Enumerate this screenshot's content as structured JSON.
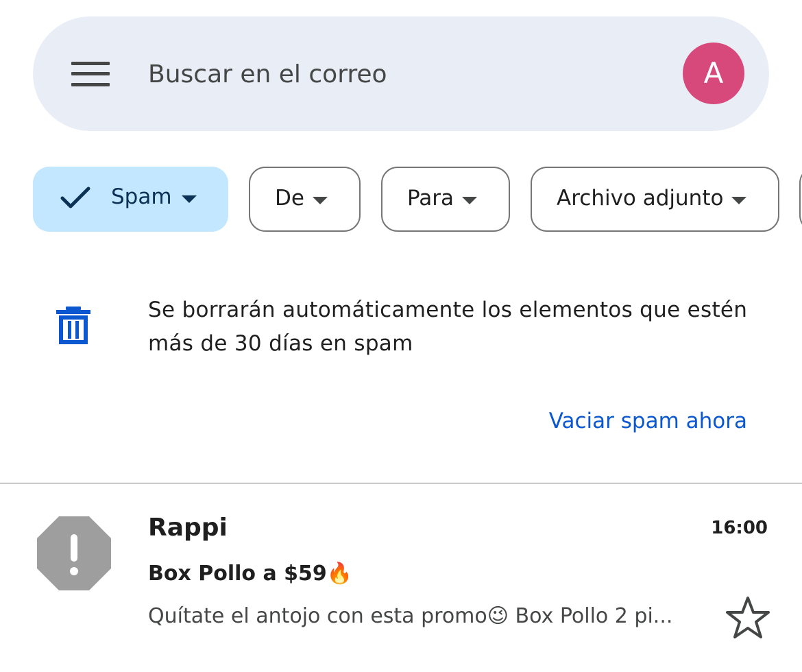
{
  "search": {
    "placeholder": "Buscar en el correo",
    "menu_icon": "menu-icon",
    "avatar_initial": "A",
    "avatar_color": "#d6497a"
  },
  "filters": {
    "chips": [
      {
        "label": "Spam",
        "selected": true,
        "icon": "check-icon"
      },
      {
        "label": "De",
        "selected": false
      },
      {
        "label": "Para",
        "selected": false
      },
      {
        "label": "Archivo adjunto",
        "selected": false
      }
    ],
    "selected_color": "#c2e7ff"
  },
  "notice": {
    "icon": "trash-icon",
    "text": "Se borrarán automáticamente los elementos que estén más de 30 días en spam",
    "action_label": "Vaciar spam ahora",
    "accent_color": "#0b57d0"
  },
  "emails": [
    {
      "icon": "spam-warning-icon",
      "sender": "Rappi",
      "time": "16:00",
      "subject": "Box Pollo a $59🔥",
      "snippet": "Quítate el antojo con esta promo😉 Box Pollo 2 pi...",
      "starred": false
    }
  ]
}
